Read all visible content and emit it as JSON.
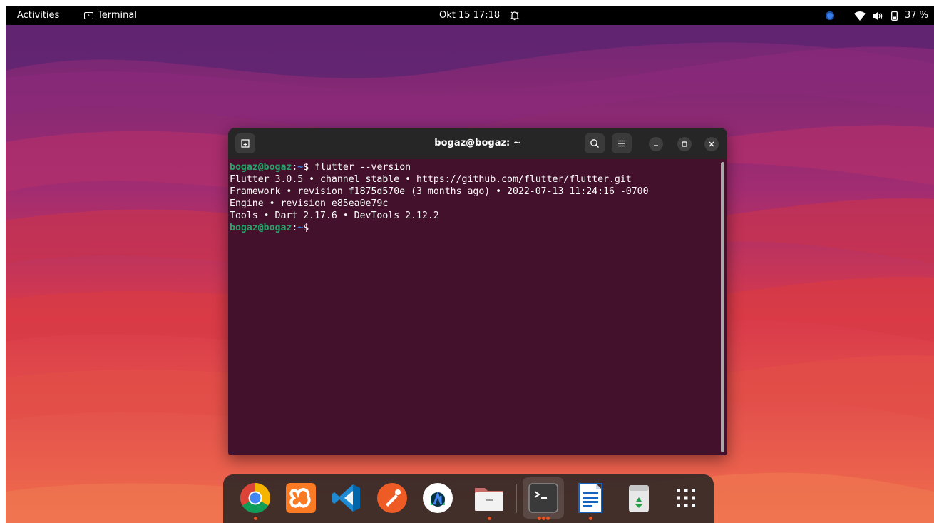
{
  "topbar": {
    "activities": "Activities",
    "app_name": "Terminal",
    "clock": "Okt 15  17:18",
    "battery": "37 %"
  },
  "terminal": {
    "title": "bogaz@bogaz: ~",
    "lines": [
      {
        "user": "bogaz@bogaz",
        "sep": ":",
        "path": "~",
        "cmd": "$ flutter --version"
      },
      {
        "text": "Flutter 3.0.5 • channel stable • https://github.com/flutter/flutter.git"
      },
      {
        "text": "Framework • revision f1875d570e (3 months ago) • 2022-07-13 11:24:16 -0700"
      },
      {
        "text": "Engine • revision e85ea0e79c"
      },
      {
        "text": "Tools • Dart 2.17.6 • DevTools 2.12.2"
      },
      {
        "user": "bogaz@bogaz",
        "sep": ":",
        "path": "~",
        "cmd": "$"
      }
    ]
  },
  "dock": {
    "apps": [
      {
        "name": "chrome-icon",
        "running": true
      },
      {
        "name": "xampp-icon",
        "running": false
      },
      {
        "name": "vscode-icon",
        "running": false
      },
      {
        "name": "postman-icon",
        "running": false
      },
      {
        "name": "android-studio-icon",
        "running": false
      },
      {
        "name": "files-icon",
        "running": true
      },
      {
        "name": "terminal-icon",
        "running": true,
        "active": true
      },
      {
        "name": "libreoffice-writer-icon",
        "running": true
      },
      {
        "name": "trash-icon",
        "running": false
      },
      {
        "name": "show-apps-icon",
        "running": false
      }
    ]
  },
  "colors": {
    "terminal_bg": "#43112b",
    "prompt_user": "#26a269",
    "prompt_path": "#3584e4",
    "accent": "#e95420"
  }
}
